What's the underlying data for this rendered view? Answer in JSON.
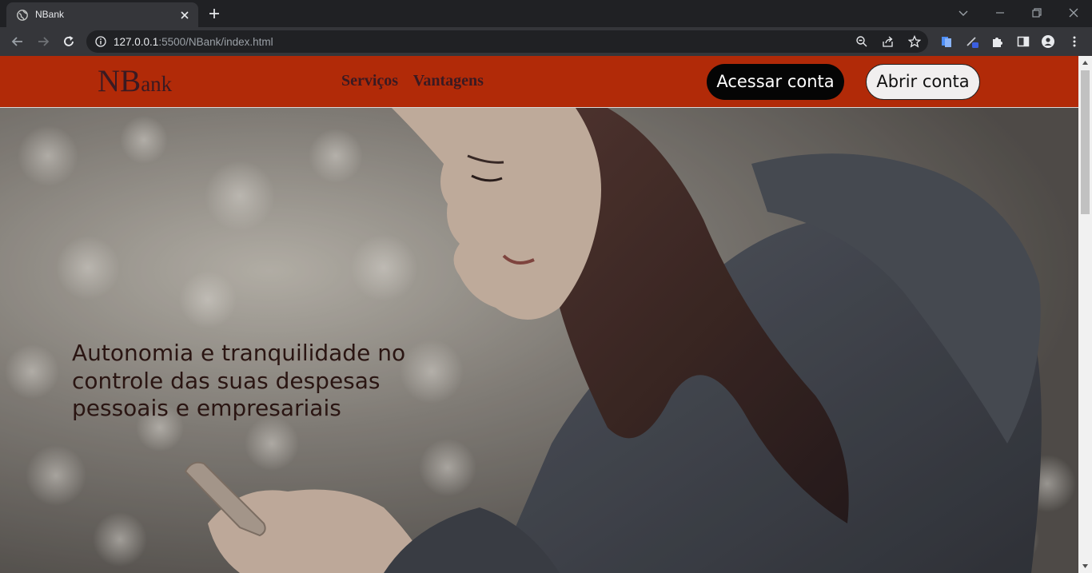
{
  "browser": {
    "tab_title": "NBank",
    "url_host": "127.0.0.1",
    "url_rest": ":5500/NBank/index.html"
  },
  "site": {
    "logo_big": "NB",
    "logo_small": "ank",
    "nav": [
      "Serviços",
      "Vantagens"
    ],
    "login_button": "Acessar conta",
    "signup_button": "Abrir conta"
  },
  "hero": {
    "headline": "Autonomia e tranquilidade no controle das suas despesas pessoais e empresariais"
  },
  "colors": {
    "header_bg": "#b12a08",
    "text_dark": "#3a1a22",
    "button_dark": "#050505",
    "button_light": "#f1efef"
  }
}
